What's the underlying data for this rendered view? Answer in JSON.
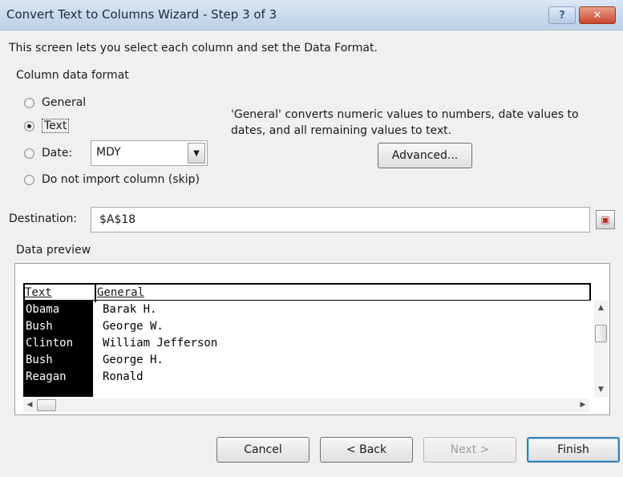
{
  "window": {
    "title": "Convert Text to Columns Wizard - Step 3 of 3",
    "help_label": "?",
    "close_label": "✕"
  },
  "intro": "This screen lets you select each column and set the Data Format.",
  "format": {
    "group_label": "Column data format",
    "options": [
      {
        "label": "General",
        "checked": false
      },
      {
        "label": "Text",
        "checked": true
      },
      {
        "label": "Date:",
        "checked": false
      },
      {
        "label": "Do not import column (skip)",
        "checked": false
      }
    ],
    "date_value": "MDY",
    "description": "'General' converts numeric values to numbers, date values to dates, and all remaining values to text.",
    "advanced_label": "Advanced..."
  },
  "destination": {
    "label": "Destination:",
    "value": "$A$18"
  },
  "preview": {
    "label": "Data preview",
    "headers": [
      "Text",
      "General"
    ],
    "rows": [
      [
        "Obama",
        "Barak H."
      ],
      [
        "Bush",
        "George W."
      ],
      [
        "Clinton",
        "William Jefferson"
      ],
      [
        "Bush",
        "George H."
      ],
      [
        "Reagan",
        "Ronald"
      ]
    ]
  },
  "buttons": {
    "cancel": "Cancel",
    "back": "< Back",
    "next": "Next >",
    "finish": "Finish"
  }
}
